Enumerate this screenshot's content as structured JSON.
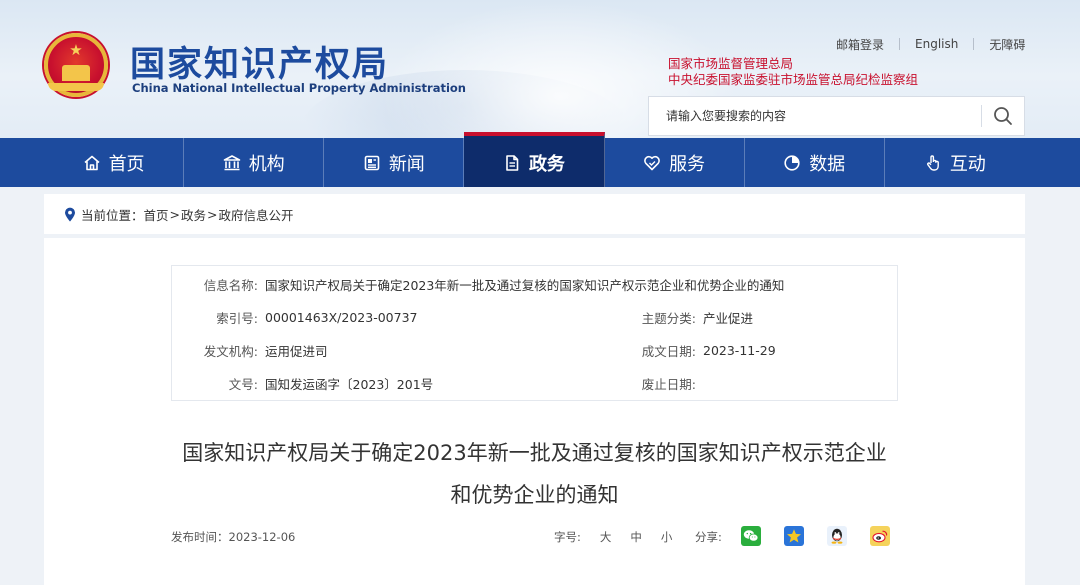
{
  "header": {
    "logo_cn": "国家知识产权局",
    "logo_en": "China National Intellectual Property Administration",
    "top_links": [
      "邮箱登录",
      "English",
      "无障碍"
    ],
    "org_line_1": "国家市场监督管理总局",
    "org_line_2": "中央纪委国家监委驻市场监管总局纪检监察组",
    "search_placeholder": "请输入您要搜索的内容"
  },
  "nav": {
    "items": [
      {
        "label": "首页",
        "icon": "home-icon"
      },
      {
        "label": "机构",
        "icon": "institution-icon"
      },
      {
        "label": "新闻",
        "icon": "newspaper-icon"
      },
      {
        "label": "政务",
        "icon": "document-icon",
        "active": true
      },
      {
        "label": "服务",
        "icon": "service-icon"
      },
      {
        "label": "数据",
        "icon": "pie-chart-icon"
      },
      {
        "label": "互动",
        "icon": "hand-pointer-icon"
      }
    ]
  },
  "breadcrumb": {
    "prefix": "当前位置：",
    "items": [
      "首页",
      "政务",
      "政府信息公开"
    ]
  },
  "info": {
    "name_label": "信息名称:",
    "name_value": "国家知识产权局关于确定2023年新一批及通过复核的国家知识产权示范企业和优势企业的通知",
    "index_label": "索引号:",
    "index_value": "00001463X/2023-00737",
    "topic_label": "主题分类:",
    "topic_value": "产业促进",
    "issuer_label": "发文机构:",
    "issuer_value": "运用促进司",
    "date_label": "成文日期:",
    "date_value": "2023-11-29",
    "docno_label": "文号:",
    "docno_value": "国知发运函字〔2023〕201号",
    "expire_label": "废止日期:",
    "expire_value": ""
  },
  "article": {
    "title_line_1": "国家知识产权局关于确定2023年新一批及通过复核的国家知识产权示范企业",
    "title_line_2": "和优势企业的通知",
    "publish_time": "发布时间：2023-12-06",
    "font_size_label": "字号:",
    "font_sizes": [
      "大",
      "中",
      "小"
    ],
    "share_label": "分享:",
    "share_icons": [
      "wechat-icon",
      "qzone-icon",
      "qq-icon",
      "weibo-icon"
    ]
  },
  "colors": {
    "brand_blue": "#1d4b9e",
    "active_nav": "#0e2c6b",
    "accent_red": "#c8102e"
  }
}
